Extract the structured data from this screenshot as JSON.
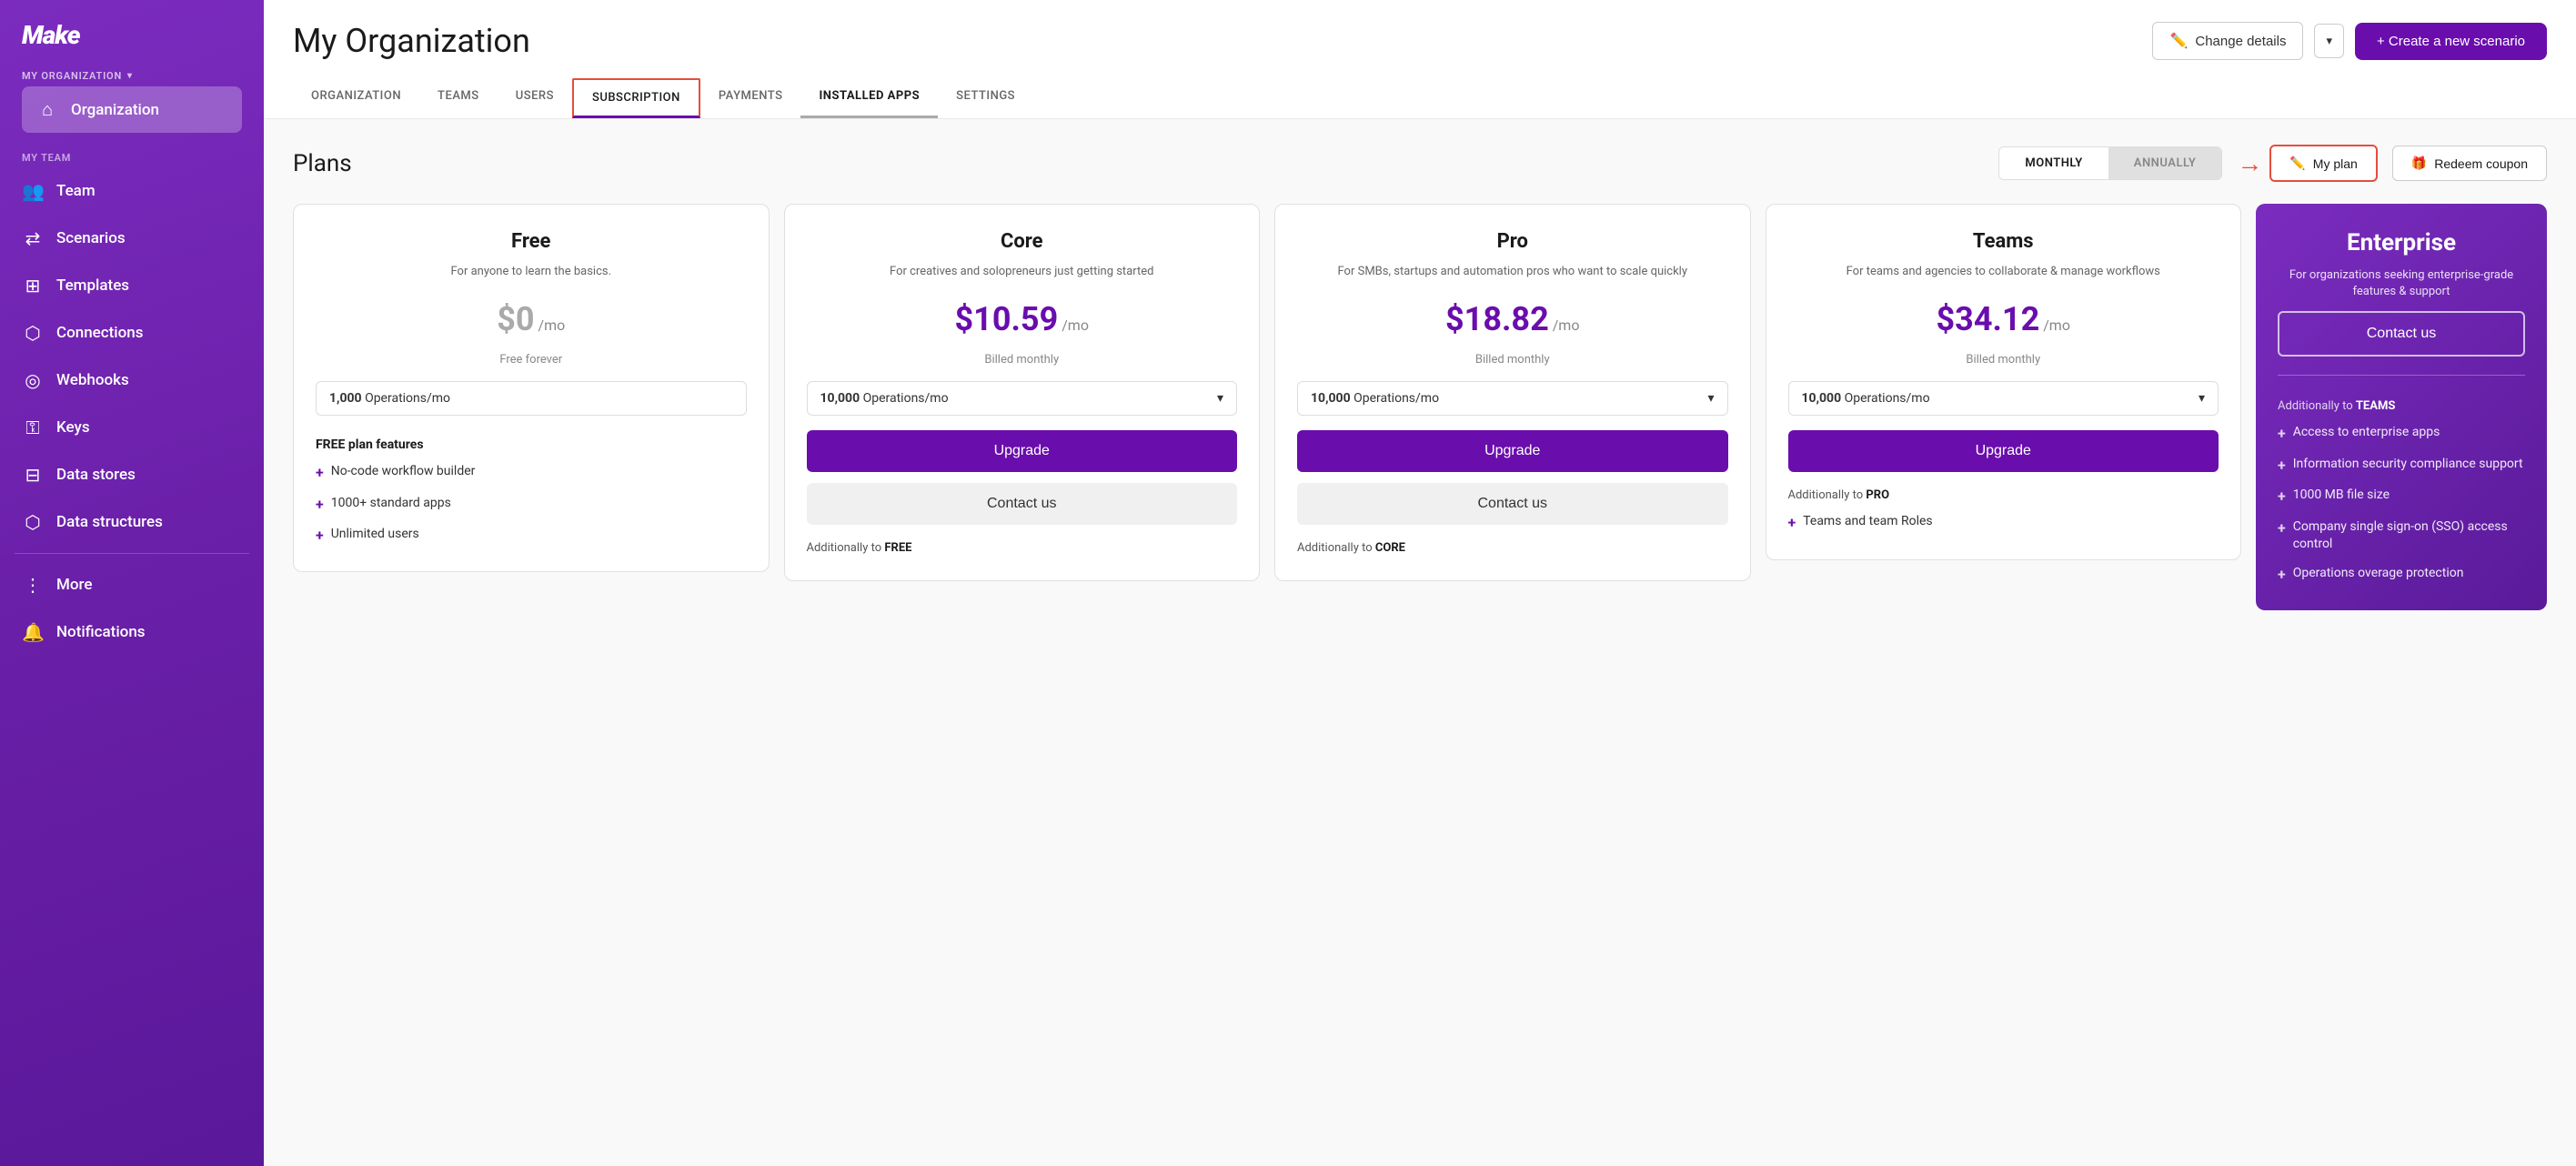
{
  "sidebar": {
    "logo": "M",
    "org_section_label": "MY ORGANIZATION",
    "org_chevron": "▾",
    "active_item": "Organization",
    "team_section_label": "MY TEAM",
    "nav_items": [
      {
        "id": "organization",
        "label": "Organization",
        "icon": "⌂",
        "active": true
      },
      {
        "id": "team",
        "label": "Team",
        "icon": "👥"
      },
      {
        "id": "scenarios",
        "label": "Scenarios",
        "icon": "⇄"
      },
      {
        "id": "templates",
        "label": "Templates",
        "icon": "⊞"
      },
      {
        "id": "connections",
        "label": "Connections",
        "icon": "⬡"
      },
      {
        "id": "webhooks",
        "label": "Webhooks",
        "icon": "◎"
      },
      {
        "id": "keys",
        "label": "Keys",
        "icon": "⚿"
      },
      {
        "id": "data-stores",
        "label": "Data stores",
        "icon": "⊟"
      },
      {
        "id": "data-structures",
        "label": "Data structures",
        "icon": "⬡"
      }
    ],
    "more_label": "More",
    "notifications_label": "Notifications"
  },
  "header": {
    "page_title": "My Organization",
    "change_details_label": "Change details",
    "create_scenario_label": "+ Create a new scenario",
    "tabs": [
      {
        "id": "organization",
        "label": "ORGANIZATION"
      },
      {
        "id": "teams",
        "label": "TEAMS"
      },
      {
        "id": "users",
        "label": "USERS"
      },
      {
        "id": "subscription",
        "label": "SUBSCRIPTION",
        "active": true
      },
      {
        "id": "payments",
        "label": "PAYMENTS"
      },
      {
        "id": "installed-apps",
        "label": "INSTALLED APPS",
        "underline": true
      },
      {
        "id": "settings",
        "label": "SETTINGS"
      }
    ]
  },
  "plans_section": {
    "title": "Plans",
    "billing_monthly": "MONTHLY",
    "billing_annually": "ANNUALLY",
    "my_plan_label": "My plan",
    "redeem_coupon_label": "Redeem coupon",
    "plans": [
      {
        "id": "free",
        "name": "Free",
        "description": "For anyone to learn the basics.",
        "price": "$0",
        "price_suffix": "/mo",
        "price_note": "Free forever",
        "ops": "1,000",
        "ops_unit": "Operations/mo",
        "features_label": "FREE plan features",
        "features": [
          "No-code workflow builder",
          "1000+ standard apps",
          "Unlimited users"
        ],
        "show_upgrade": false,
        "show_contact": false
      },
      {
        "id": "core",
        "name": "Core",
        "description": "For creatives and solopreneurs just getting started",
        "price": "$10.59",
        "price_suffix": "/mo",
        "price_note": "Billed monthly",
        "ops": "10,000",
        "ops_unit": "Operations/mo",
        "additionally_label": "Additionally to FREE",
        "show_upgrade": true,
        "show_contact": true
      },
      {
        "id": "pro",
        "name": "Pro",
        "description": "For SMBs, startups and automation pros who want to scale quickly",
        "price": "$18.82",
        "price_suffix": "/mo",
        "price_note": "Billed monthly",
        "ops": "10,000",
        "ops_unit": "Operations/mo",
        "additionally_label": "Additionally to CORE",
        "show_upgrade": true,
        "show_contact": true
      },
      {
        "id": "teams",
        "name": "Teams",
        "description": "For teams and agencies to collaborate & manage workflows",
        "price": "$34.12",
        "price_suffix": "/mo",
        "price_note": "Billed monthly",
        "ops": "10,000",
        "ops_unit": "Operations/mo",
        "additionally_label": "Additionally to PRO",
        "features": [
          "Teams and team Roles"
        ],
        "show_upgrade": true,
        "show_contact": false
      },
      {
        "id": "enterprise",
        "name": "Enterprise",
        "description": "For organizations seeking enterprise-grade features & support",
        "contact_label": "Contact us",
        "additionally_label": "Additionally to TEAMS",
        "features": [
          "Access to enterprise apps",
          "Information security compliance support",
          "1000 MB file size",
          "Company single sign-on (SSO) access control",
          "Operations overage protection"
        ]
      }
    ]
  }
}
